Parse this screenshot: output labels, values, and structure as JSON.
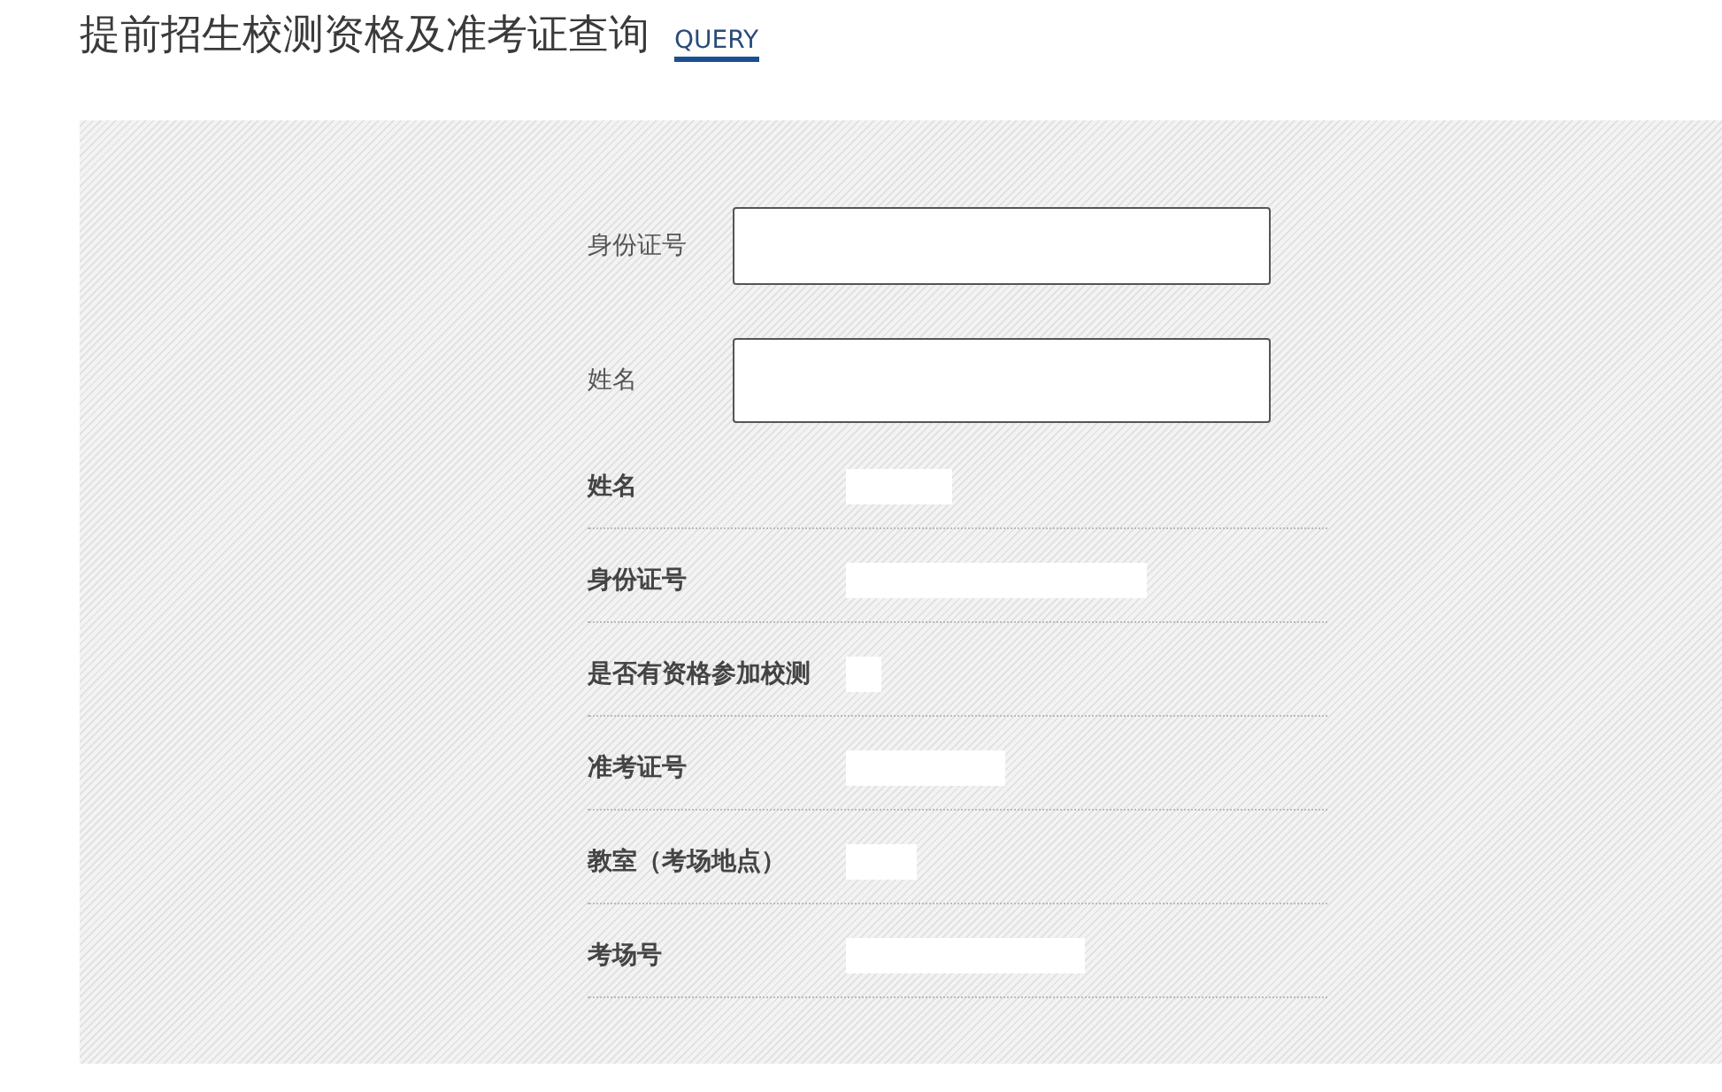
{
  "page": {
    "title": "提前招生校测资格及准考证查询",
    "subtitle": "QUERY"
  },
  "form": {
    "fields": [
      {
        "label": "身份证号"
      },
      {
        "label": "姓名"
      }
    ]
  },
  "results": [
    {
      "label": "姓名"
    },
    {
      "label": "身份证号"
    },
    {
      "label": "是否有资格参加校测"
    },
    {
      "label": "准考证号"
    },
    {
      "label": "教室（考场地点）"
    },
    {
      "label": "考场号"
    }
  ]
}
